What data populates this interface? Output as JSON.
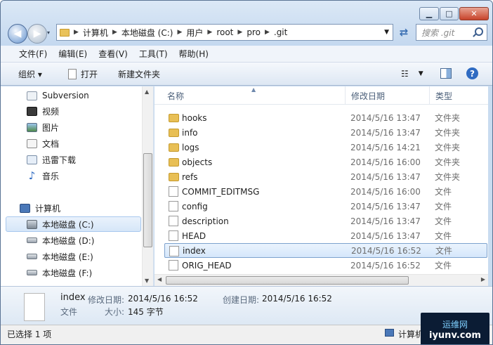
{
  "address": {
    "crumbs": [
      "计算机",
      "本地磁盘 (C:)",
      "用户",
      "root",
      "pro",
      ".git"
    ]
  },
  "search": {
    "placeholder": "搜索 .git"
  },
  "menu": [
    "文件(F)",
    "编辑(E)",
    "查看(V)",
    "工具(T)",
    "帮助(H)"
  ],
  "toolbar": {
    "organize": "组织 ▾",
    "open": "打开",
    "new_folder": "新建文件夹"
  },
  "nav": {
    "items": [
      {
        "label": "Subversion",
        "icon": "subversion-icon"
      },
      {
        "label": "视频",
        "icon": "video-library-icon"
      },
      {
        "label": "图片",
        "icon": "pictures-library-icon"
      },
      {
        "label": "文档",
        "icon": "documents-library-icon"
      },
      {
        "label": "迅雷下载",
        "icon": "thunder-download-icon"
      },
      {
        "label": "音乐",
        "icon": "music-library-icon"
      },
      {
        "label": "计算机",
        "icon": "computer-icon"
      },
      {
        "label": "本地磁盘 (C:)",
        "icon": "system-drive-icon",
        "selected": true
      },
      {
        "label": "本地磁盘 (D:)",
        "icon": "drive-icon"
      },
      {
        "label": "本地磁盘 (E:)",
        "icon": "drive-icon"
      },
      {
        "label": "本地磁盘 (F:)",
        "icon": "drive-icon"
      }
    ]
  },
  "columns": {
    "name": "名称",
    "date": "修改日期",
    "type": "类型"
  },
  "files": [
    {
      "name": "hooks",
      "date": "2014/5/16 13:47",
      "type": "文件夹",
      "kind": "folder"
    },
    {
      "name": "info",
      "date": "2014/5/16 13:47",
      "type": "文件夹",
      "kind": "folder"
    },
    {
      "name": "logs",
      "date": "2014/5/16 14:21",
      "type": "文件夹",
      "kind": "folder"
    },
    {
      "name": "objects",
      "date": "2014/5/16 16:00",
      "type": "文件夹",
      "kind": "folder"
    },
    {
      "name": "refs",
      "date": "2014/5/16 13:47",
      "type": "文件夹",
      "kind": "folder"
    },
    {
      "name": "COMMIT_EDITMSG",
      "date": "2014/5/16 16:00",
      "type": "文件",
      "kind": "file"
    },
    {
      "name": "config",
      "date": "2014/5/16 13:47",
      "type": "文件",
      "kind": "file"
    },
    {
      "name": "description",
      "date": "2014/5/16 13:47",
      "type": "文件",
      "kind": "file"
    },
    {
      "name": "HEAD",
      "date": "2014/5/16 13:47",
      "type": "文件",
      "kind": "file"
    },
    {
      "name": "index",
      "date": "2014/5/16 16:52",
      "type": "文件",
      "kind": "file",
      "selected": true
    },
    {
      "name": "ORIG_HEAD",
      "date": "2014/5/16 16:52",
      "type": "文件",
      "kind": "file"
    }
  ],
  "details": {
    "name": "index",
    "type": "文件",
    "modified_label": "修改日期:",
    "modified": "2014/5/16 16:52",
    "created_label": "创建日期:",
    "created": "2014/5/16 16:52",
    "size_label": "大小:",
    "size": "145 字节"
  },
  "status": {
    "selection": "已选择 1 项",
    "location": "计算机"
  },
  "watermark": {
    "line1": "运维网",
    "line2": "iyunv.com"
  },
  "colors": {
    "selection_bg": "#d5e7fb",
    "selection_border": "#7da2ce",
    "folder": "#e8bf55"
  }
}
